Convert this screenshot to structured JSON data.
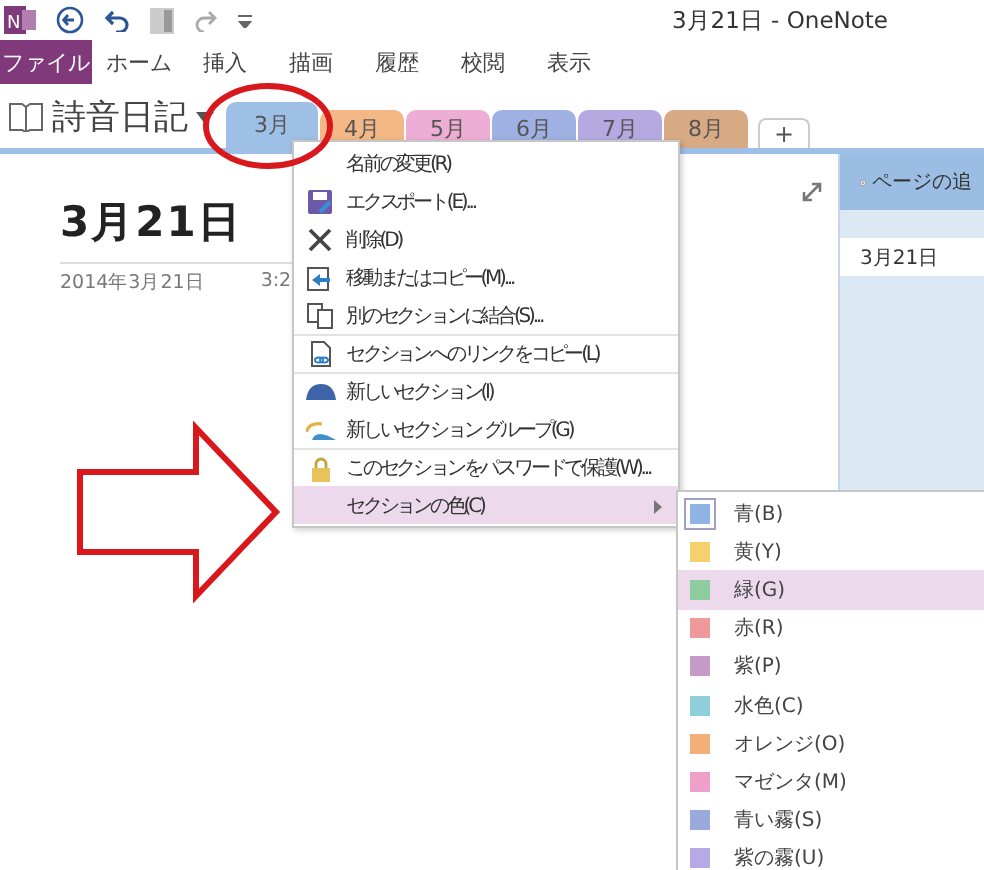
{
  "window": {
    "title": "3月21日 - OneNote",
    "logo_text": "N"
  },
  "ribbon_tabs": [
    {
      "label": "ファイル",
      "selected": true
    },
    {
      "label": "ホーム",
      "selected": false
    },
    {
      "label": "挿入",
      "selected": false
    },
    {
      "label": "描画",
      "selected": false
    },
    {
      "label": "履歴",
      "selected": false
    },
    {
      "label": "校閲",
      "selected": false
    },
    {
      "label": "表示",
      "selected": false
    }
  ],
  "notebook": {
    "name": "詩音日記"
  },
  "section_tabs": [
    {
      "label": "3月",
      "color": "#9fc0e6",
      "selected": true
    },
    {
      "label": "4月",
      "color": "#f3b886",
      "selected": false
    },
    {
      "label": "5月",
      "color": "#eeadd4",
      "selected": false
    },
    {
      "label": "6月",
      "color": "#9eb1e2",
      "selected": false
    },
    {
      "label": "7月",
      "color": "#b6a9e2",
      "selected": false
    },
    {
      "label": "8月",
      "color": "#d8aa84",
      "selected": false
    }
  ],
  "add_section": "+",
  "page": {
    "title": "3月21日",
    "date": "2014年3月21日",
    "time": "3:2"
  },
  "page_list": {
    "add_page": "ページの追",
    "pages": [
      {
        "title": "3月21日",
        "selected": true
      }
    ]
  },
  "context_menu": [
    {
      "label": "名前の変更(R)",
      "divider_above": false,
      "selected": false
    },
    {
      "label": "エクスポート(E)...",
      "divider_above": false,
      "selected": false
    },
    {
      "label": "削除(D)",
      "divider_above": false,
      "selected": false
    },
    {
      "label": "移動またはコピー(M)...",
      "divider_above": false,
      "selected": false
    },
    {
      "label": "別のセクションに結合(S)...",
      "divider_above": false,
      "selected": false
    },
    {
      "label": "セクションへのリンクをコピー(L)",
      "divider_above": true,
      "selected": false
    },
    {
      "label": "新しいセクション(I)",
      "divider_above": true,
      "selected": false
    },
    {
      "label": "新しいセクション グループ(G)",
      "divider_above": false,
      "selected": false
    },
    {
      "label": "このセクションをパスワードで保護(W)...",
      "divider_above": true,
      "selected": false
    },
    {
      "label": "セクションの色(C)",
      "divider_above": false,
      "selected": true
    }
  ],
  "color_menu": [
    {
      "label": "青(B)",
      "color": "#8fb4e3",
      "current": true,
      "selected": false
    },
    {
      "label": "黄(Y)",
      "color": "#f5d06f",
      "current": false,
      "selected": false
    },
    {
      "label": "緑(G)",
      "color": "#8ccc9e",
      "current": false,
      "selected": true
    },
    {
      "label": "赤(R)",
      "color": "#ee9a9a",
      "current": false,
      "selected": false
    },
    {
      "label": "紫(P)",
      "color": "#c69ac6",
      "current": false,
      "selected": false
    },
    {
      "label": "水色(C)",
      "color": "#8fd0dc",
      "current": false,
      "selected": false
    },
    {
      "label": "オレンジ(O)",
      "color": "#f3b07a",
      "current": false,
      "selected": false
    },
    {
      "label": "マゼンタ(M)",
      "color": "#eea0c8",
      "current": false,
      "selected": false
    },
    {
      "label": "青い霧(S)",
      "color": "#9aa9dc",
      "current": false,
      "selected": false
    },
    {
      "label": "紫の霧(U)",
      "color": "#b7a8e6",
      "current": false,
      "selected": false
    }
  ]
}
